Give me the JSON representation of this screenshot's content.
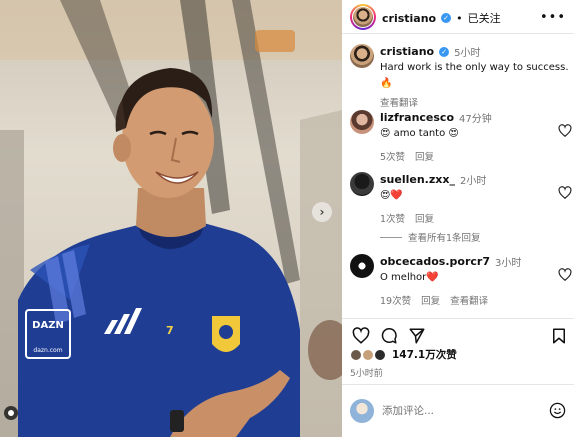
{
  "post": {
    "username": "cristiano",
    "follow_state": "已关注",
    "separator": "•",
    "more": "•••",
    "caption": {
      "username": "cristiano",
      "time": "5小时",
      "text": "Hard work is the only way to success.",
      "emoji": "🔥",
      "see_translation": "查看翻译"
    }
  },
  "comments": [
    {
      "username": "lizfrancesco",
      "time": "47分钟",
      "text": "😍 amo tanto 😍",
      "likes": "5次赞",
      "reply": "回复"
    },
    {
      "username": "suellen.zxx_",
      "time": "2小时",
      "text": "😍❤️",
      "likes": "1次赞",
      "reply": "回复"
    },
    {
      "username": "obcecados.porcr7",
      "time": "3小时",
      "text": "O melhor❤️",
      "likes": "19次赞",
      "reply": "回复",
      "translate": "查看翻译"
    }
  ],
  "view_replies": "查看所有1条回复",
  "likes_count": "147.1万次赞",
  "post_time": "5小时前",
  "add_comment_placeholder": "添加评论...",
  "photo": {
    "jersey_sponsor": "DAZN",
    "jersey_sponsor_sub": "dazn.com",
    "jersey_number": "7"
  },
  "colors": {
    "verified": "#3897f0",
    "jersey": "#1f3d93",
    "text_secondary": "#737373"
  },
  "icons": {
    "verified": "verified-badge-icon",
    "more": "more-horizontal-icon",
    "heart": "heart-outline-icon",
    "comment": "comment-bubble-icon",
    "share": "paper-plane-icon",
    "save": "bookmark-icon",
    "emoji": "emoji-smile-icon",
    "next": "chevron-right-icon",
    "tagged": "tagged-user-icon"
  }
}
